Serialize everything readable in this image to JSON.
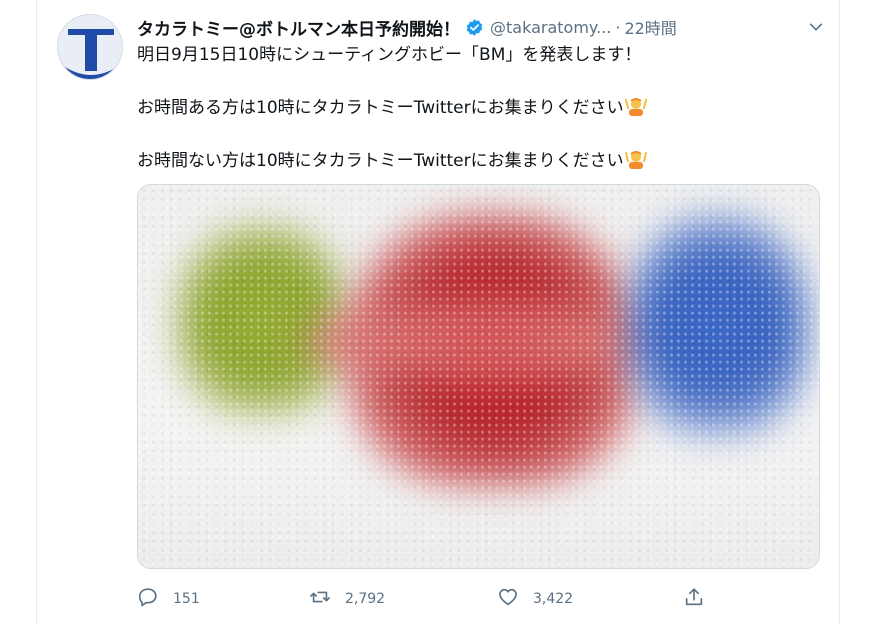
{
  "tweet": {
    "display_name": "タカラトミー@ボトルマン本日予約開始！",
    "handle": "@takaratomy...",
    "separator": "·",
    "time": "22時間",
    "lines": [
      "明日9月15日10時にシューティングホビー「BM」を発表します！",
      "お時間ある方は10時にタカラトミーTwitterにお集まりください",
      "お時間ない方は10時にタカラトミーTwitterにお集まりください"
    ]
  },
  "actions": {
    "reply_count": "151",
    "retweet_count": "2,792",
    "like_count": "3,422"
  },
  "icons": {
    "verified": "verified-badge-icon",
    "chevron": "chevron-down-icon",
    "reply": "reply-icon",
    "retweet": "retweet-icon",
    "like": "heart-icon",
    "share": "share-icon",
    "emoji": "person-raising-hand-emoji"
  },
  "colors": {
    "accent": "#1d9bf0",
    "secondary_text": "#5b7083",
    "primary_text": "#0f1419"
  }
}
